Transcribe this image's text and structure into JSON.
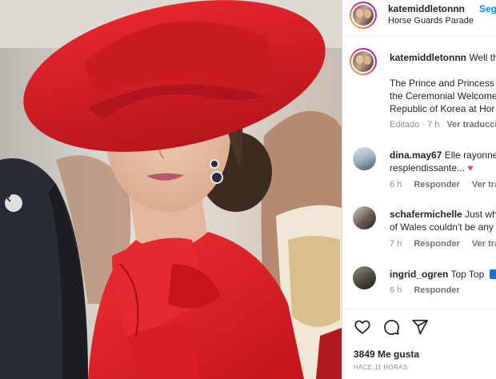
{
  "post": {
    "username": "katemiddletonnn",
    "follow_label": "Seguir",
    "location": "Horse Guards Parade",
    "caption_lead": "Well th",
    "caption_lines": [
      "The Prince and Princess o",
      "the Ceremonial Welcome",
      "Republic of Korea at Hor"
    ],
    "caption_meta": "Editado · 7 h",
    "caption_translate": "Ver traducción"
  },
  "comments": [
    {
      "username": "dina.may67",
      "text": "Elle rayonne",
      "line2": "resplendissante...",
      "emoji": "♥",
      "time": "6 h",
      "reply": "Responder",
      "translate": "Ver traducc"
    },
    {
      "username": "schafermichelle",
      "text": "Just whe",
      "line2": "of Wales couldn't be any",
      "time": "7 h",
      "reply": "Responder",
      "translate": "Ver traducc"
    },
    {
      "username": "ingrid_ogren",
      "text": "Top Top",
      "time": "6 h",
      "reply": "Responder"
    }
  ],
  "footer": {
    "likes": "3849 Me gusta",
    "time_ago": "HACE 11 HORAS"
  },
  "icons": {
    "like": "heart-outline-icon",
    "comment": "speech-bubble-icon",
    "share": "paper-plane-icon",
    "carousel_prev": "chevron-left-icon"
  },
  "colors": {
    "accent": "#0095f6",
    "hat": "#d41f26",
    "coat": "#e3202a"
  }
}
